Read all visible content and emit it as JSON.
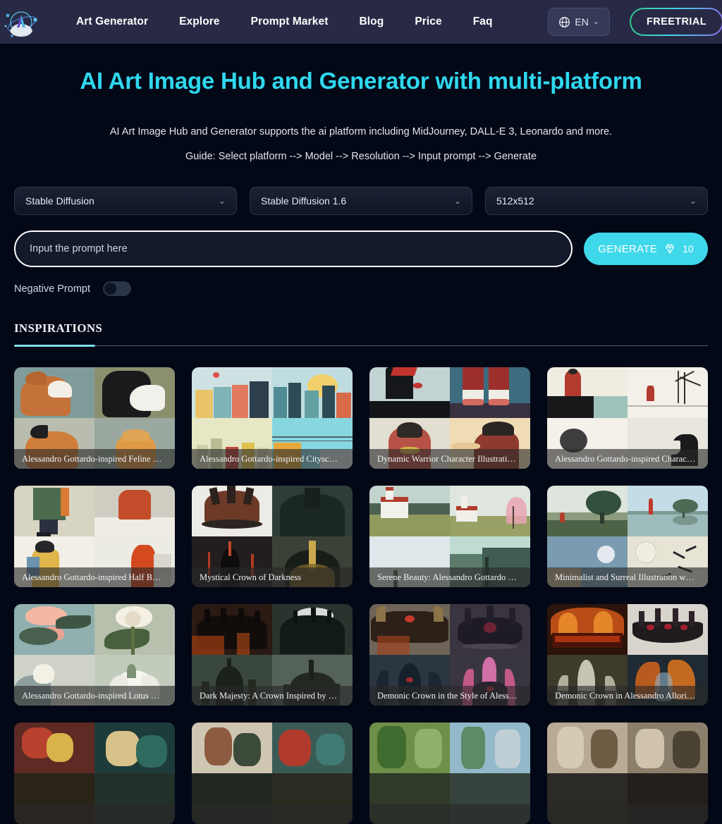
{
  "header": {
    "logo_alt": "AI Art Image Hub logo",
    "nav": [
      {
        "label": "Art Generator"
      },
      {
        "label": "Explore"
      },
      {
        "label": "Prompt Market"
      },
      {
        "label": "Blog"
      },
      {
        "label": "Price"
      },
      {
        "label": "Faq"
      }
    ],
    "language": {
      "value": "EN",
      "icon": "globe-icon",
      "chevron": "⌄"
    },
    "cta": {
      "label": "FREETRIAL"
    }
  },
  "hero": {
    "title": "AI Art Image Hub and Generator with multi-platform",
    "subtitle": "AI Art Image Hub and Generator supports the ai platform including MidJourney, DALL-E 3, Leonardo and more.",
    "guide": "Guide: Select platform --> Model --> Resolution --> Input prompt --> Generate"
  },
  "controls": {
    "platform": {
      "value": "Stable Diffusion",
      "chevron": "⌄"
    },
    "model": {
      "value": "Stable Diffusion 1.6",
      "chevron": "⌄"
    },
    "resolution": {
      "value": "512x512",
      "chevron": "⌄"
    },
    "prompt": {
      "placeholder": "Input the prompt here",
      "value": ""
    },
    "generate": {
      "label": "GENERATE",
      "credits": "10",
      "icon": "diamond-icon"
    },
    "negative_prompt": {
      "label": "Negative Prompt",
      "enabled": false
    }
  },
  "tabs": [
    {
      "label": "INSPIRATIONS",
      "active": true
    }
  ],
  "gallery": {
    "cards": [
      {
        "caption": "Alessandro Gottardo-inspired Feline …",
        "theme": "cats"
      },
      {
        "caption": "Alessandro Gottardo-inspired Citysc…",
        "theme": "city"
      },
      {
        "caption": "Dynamic Warrior Character Illustrati…",
        "theme": "warrior"
      },
      {
        "caption": "Alessandro Gottardo-inspired Charac…",
        "theme": "minimal-figure"
      },
      {
        "caption": "Alessandro Gottardo-inspired Half B…",
        "theme": "half-body"
      },
      {
        "caption": "Mystical Crown of Darkness",
        "theme": "dark-crown"
      },
      {
        "caption": "Serene Beauty: Alessandro Gottardo …",
        "theme": "church"
      },
      {
        "caption": "Minimalist and Surreal Illustration w…",
        "theme": "tree"
      },
      {
        "caption": "Alessandro Gottardo-inspired Lotus …",
        "theme": "lotus"
      },
      {
        "caption": "Dark Majesty: A Crown Inspired by …",
        "theme": "dark-majesty"
      },
      {
        "caption": "Demonic Crown in the Style of Aless…",
        "theme": "demonic-1"
      },
      {
        "caption": "Demonic Crown in Alessandro Allori…",
        "theme": "demonic-2"
      },
      {
        "caption": "",
        "theme": "row4-a"
      },
      {
        "caption": "",
        "theme": "row4-b"
      },
      {
        "caption": "",
        "theme": "row4-c"
      },
      {
        "caption": "",
        "theme": "row4-d"
      }
    ]
  },
  "colors": {
    "page_background": "#030817",
    "header_background": "#282a45",
    "accent_cyan": "#2fd8ee",
    "generate_button": "#3fd8ea",
    "tab_underline": "#7fdbe8"
  }
}
